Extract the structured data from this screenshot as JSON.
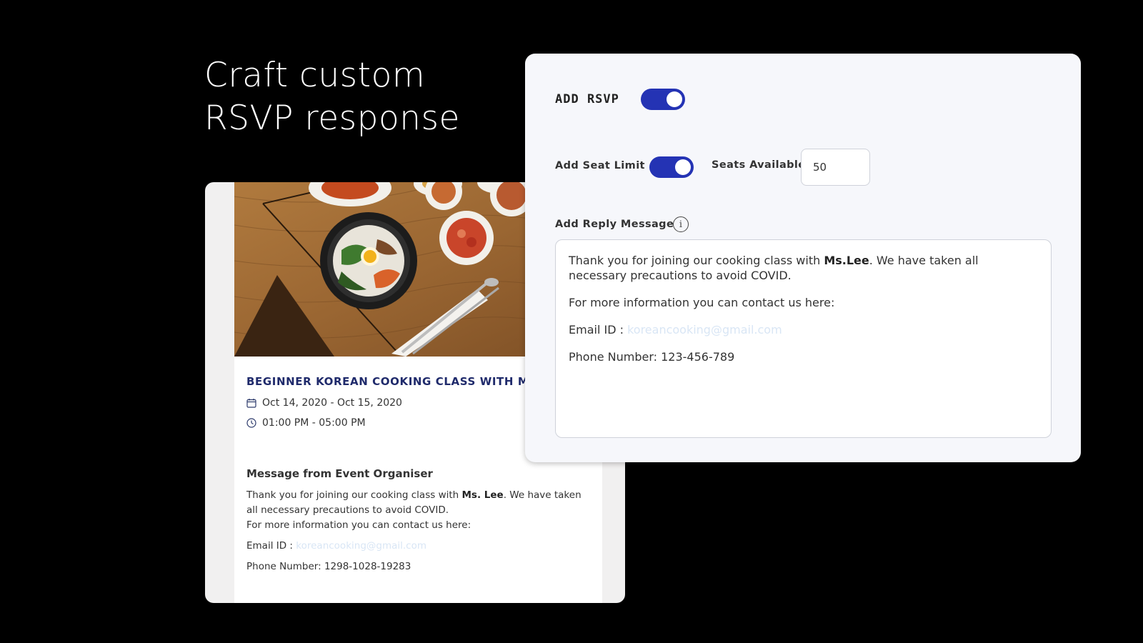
{
  "headline": {
    "line1": "Craft custom",
    "line2": "RSVP response"
  },
  "event": {
    "title": "BEGINNER KOREAN COOKING CLASS WITH M",
    "date_range": "Oct 14, 2020 - Oct 15, 2020",
    "time_range": "01:00 PM - 05:00 PM",
    "message_heading": "Message from Event Organiser",
    "message": {
      "intro_before": "Thank you for joining our cooking class with ",
      "intro_bold": "Ms. Lee",
      "intro_after": ". We have taken all necessary precautions to avoid COVID.",
      "contact_line": "For more information you can contact us here:",
      "email_label": "Email ID : ",
      "email_value": "koreancooking@gmail.com",
      "phone_line": "Phone Number: 1298-1028-19283"
    }
  },
  "settings": {
    "add_rsvp_label": "ADD RSVP",
    "add_rsvp_enabled": true,
    "seat_limit_label": "Add Seat Limit",
    "seat_limit_enabled": true,
    "seats_available_label": "Seats Available",
    "seats_available_value": "50",
    "reply_message_label": "Add Reply Message",
    "info_icon_glyph": "i",
    "reply": {
      "intro_before": "Thank you for joining our cooking class with ",
      "intro_bold": "Ms.Lee",
      "intro_after": ". We have taken all necessary precautions to avoid COVID.",
      "contact_line": "For more information you can contact us here:",
      "email_label": "Email ID : ",
      "email_value": "koreancooking@gmail.com",
      "phone_line": "Phone Number: 123-456-789"
    }
  },
  "colors": {
    "toggle_on": "#2433b4",
    "event_title": "#1f2a6b"
  }
}
